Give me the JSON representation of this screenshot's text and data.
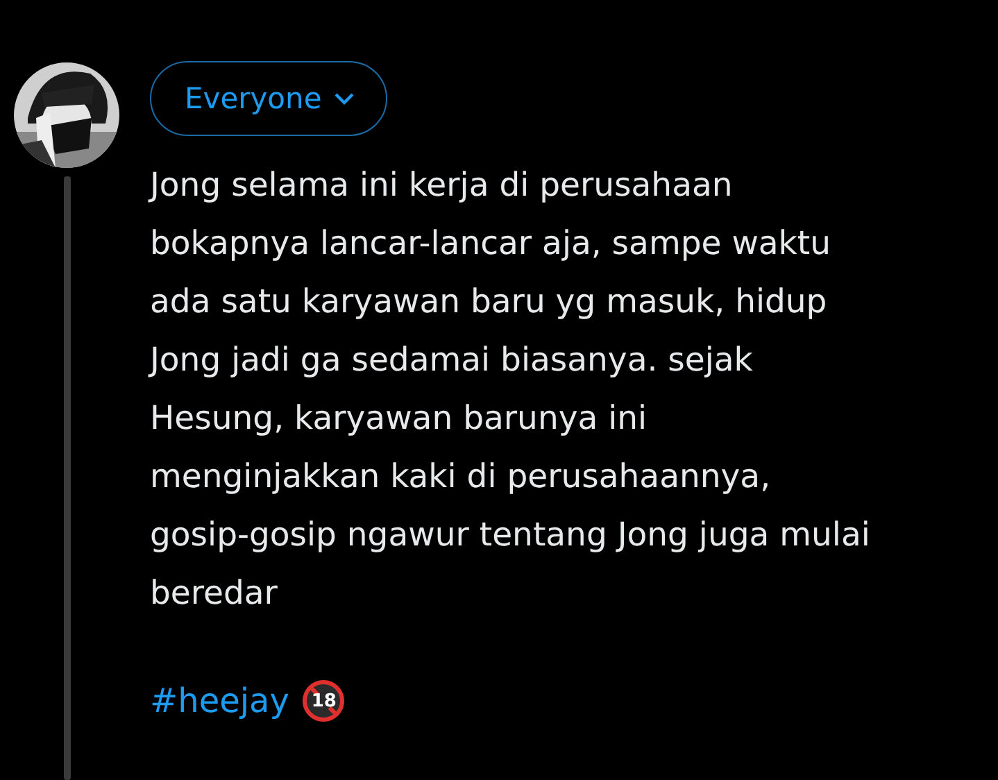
{
  "audience_button": {
    "label": "Everyone"
  },
  "body": "Jong selama ini kerja di perusahaan\nbokapnya lancar-lancar aja, sampe waktu\nada satu karyawan baru yg masuk, hidup\nJong jadi ga sedamai biasanya. sejak\nHesung, karyawan barunya ini\nmenginjakkan kaki di perusahaannya,\ngosip-gosip ngawur tentang Jong juga mulai\nberedar",
  "hashtag": "#heejay",
  "age_badge": "18"
}
